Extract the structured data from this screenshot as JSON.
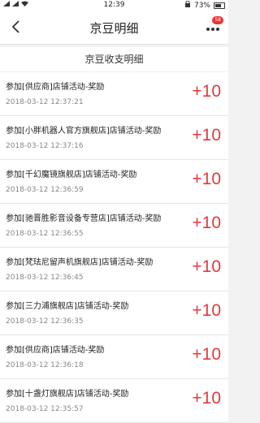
{
  "status_bar": {
    "time": "12:39",
    "battery": "73%"
  },
  "nav": {
    "title": "京豆明细",
    "badge": "58",
    "back_icon": "chevron-left-icon",
    "more_icon": "more-dots-icon"
  },
  "section": {
    "title": "京豆收支明细"
  },
  "colors": {
    "accent": "#e4393c",
    "badge": "#f23030"
  },
  "records": [
    {
      "desc": "参加[供应商]店铺活动-奖励",
      "time": "2018-03-12 12:37:21",
      "amount": "+10"
    },
    {
      "desc": "参加[小胖机器人官方旗舰店]店铺活动-奖励",
      "time": "2018-03-12 12:37:16",
      "amount": "+10"
    },
    {
      "desc": "参加[千幻魔镜旗舰店]店铺活动-奖励",
      "time": "2018-03-12 12:36:59",
      "amount": "+10"
    },
    {
      "desc": "参加[驰晋胜影音设备专营店]店铺活动-奖励",
      "time": "2018-03-12 12:36:55",
      "amount": "+10"
    },
    {
      "desc": "参加[梵珐尼留声机旗舰店]店铺活动-奖励",
      "time": "2018-03-12 12:36:45",
      "amount": "+10"
    },
    {
      "desc": "参加[三力浦旗舰店]店铺活动-奖励",
      "time": "2018-03-12 12:36:35",
      "amount": "+10"
    },
    {
      "desc": "参加[供应商]店铺活动-奖励",
      "time": "2018-03-12 12:36:18",
      "amount": "+10"
    },
    {
      "desc": "参加[十盏灯旗舰店]店铺活动-奖励",
      "time": "2018-03-12 12:35:57",
      "amount": "+10"
    }
  ]
}
